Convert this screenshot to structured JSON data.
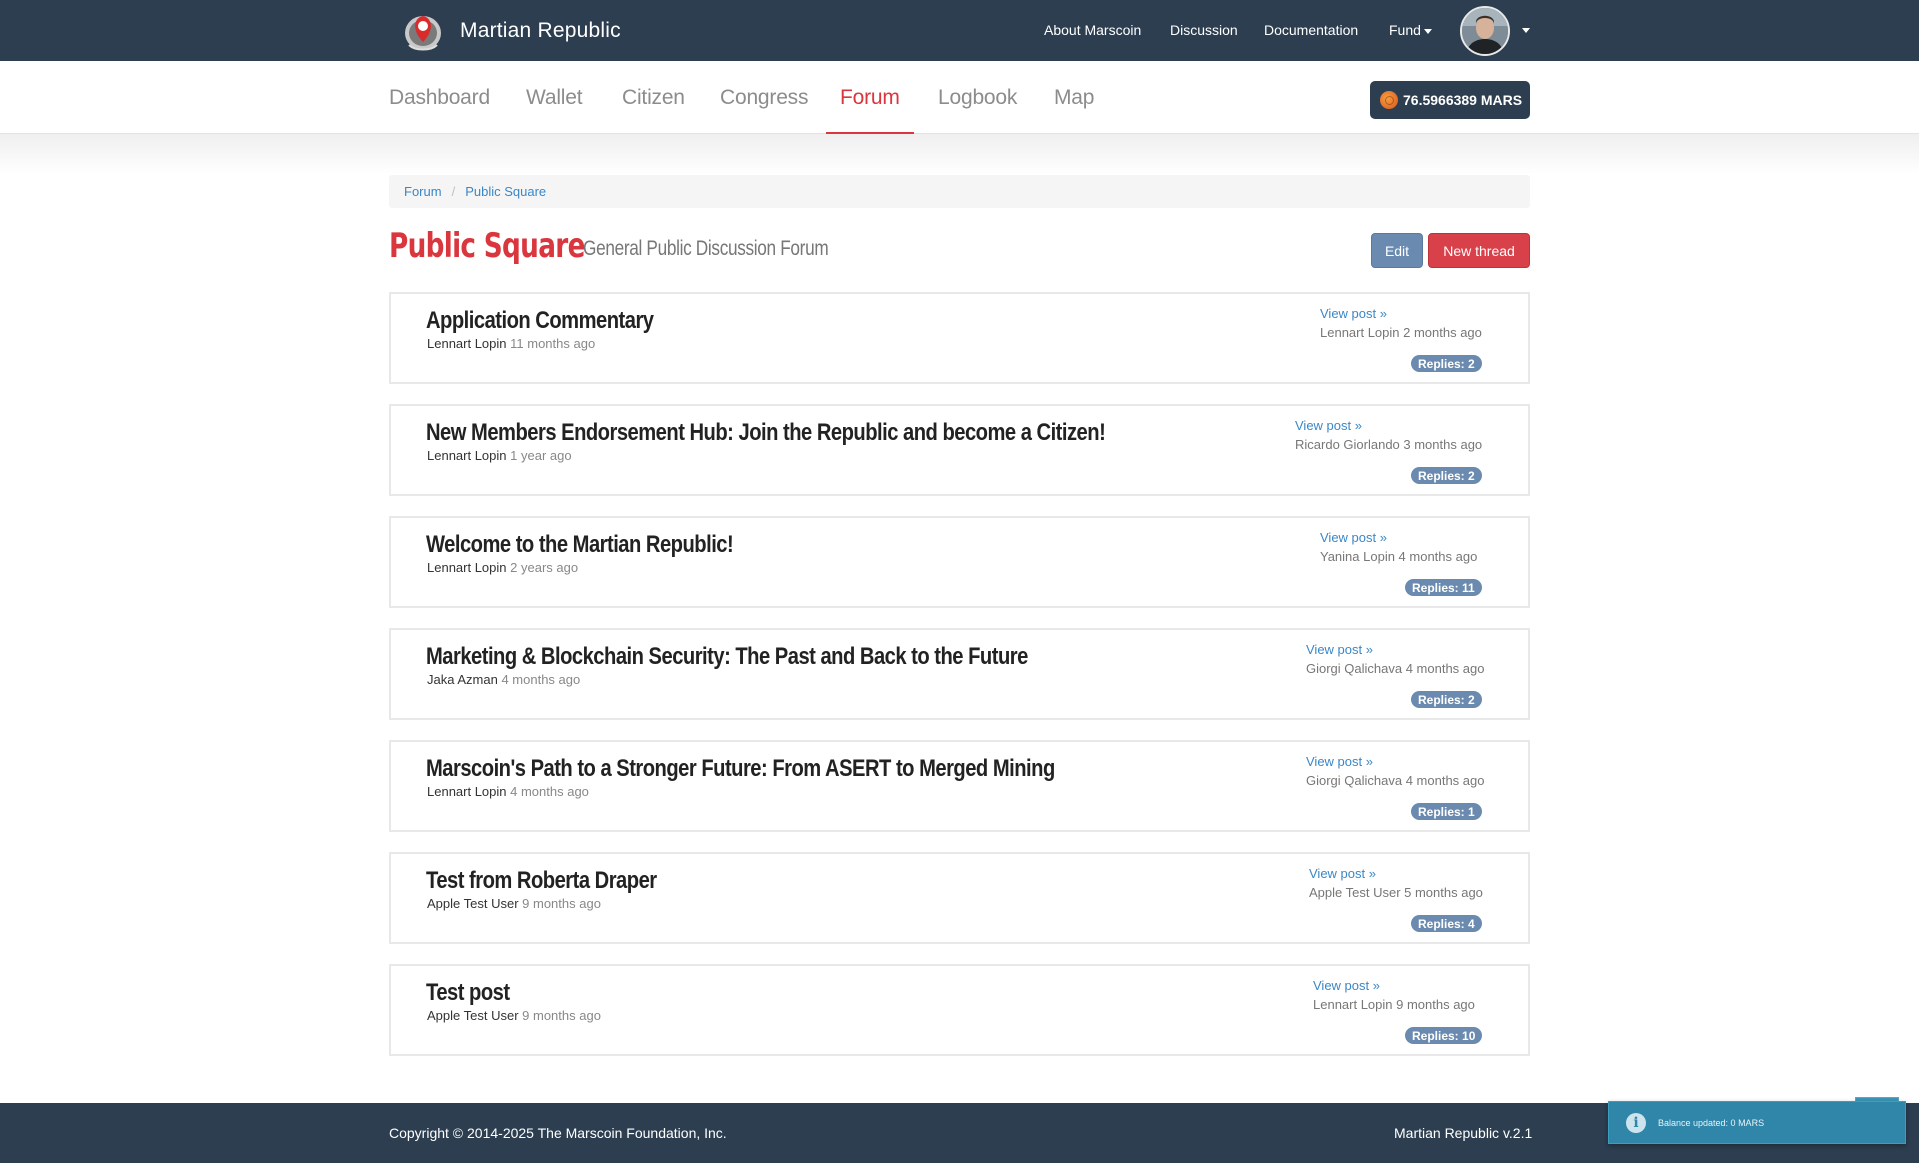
{
  "brand": {
    "name": "Martian Republic"
  },
  "top_nav": {
    "links": [
      "About Marscoin",
      "Discussion",
      "Documentation",
      "Fund"
    ]
  },
  "tabs": [
    "Dashboard",
    "Wallet",
    "Citizen",
    "Congress",
    "Forum",
    "Logbook",
    "Map"
  ],
  "active_tab": "Forum",
  "balance": {
    "label": "76.5966389 MARS"
  },
  "breadcrumb": [
    "Forum",
    "Public Square"
  ],
  "header": {
    "title": "Public Square",
    "subtitle": "General Public Discussion Forum",
    "edit_label": "Edit",
    "new_thread_label": "New thread"
  },
  "threads": [
    {
      "title": "Application Commentary",
      "author": "Lennart Lopin",
      "ago": "11 months ago",
      "view_label": "View post »",
      "last": "Lennart Lopin 2 months ago",
      "replies": "Replies: 2"
    },
    {
      "title": "New Members Endorsement Hub: Join the Republic and become a Citizen!",
      "author": "Lennart Lopin",
      "ago": "1 year ago",
      "view_label": "View post »",
      "last": "Ricardo Giorlando 3 months ago",
      "replies": "Replies: 2"
    },
    {
      "title": "Welcome to the Martian Republic!",
      "author": "Lennart Lopin",
      "ago": "2 years ago",
      "view_label": "View post »",
      "last": "Yanina Lopin 4 months ago",
      "replies": "Replies: 11"
    },
    {
      "title": "Marketing & Blockchain Security: The Past and Back to the Future",
      "author": "Jaka Azman",
      "ago": "4 months ago",
      "view_label": "View post »",
      "last": "Giorgi Qalichava 4 months ago",
      "replies": "Replies: 2"
    },
    {
      "title": "Marscoin's Path to a Stronger Future: From ASERT to Merged Mining",
      "author": "Lennart Lopin",
      "ago": "4 months ago",
      "view_label": "View post »",
      "last": "Giorgi Qalichava 4 months ago",
      "replies": "Replies: 1"
    },
    {
      "title": "Test from Roberta Draper",
      "author": "Apple Test User",
      "ago": "9 months ago",
      "view_label": "View post »",
      "last": "Apple Test User 5 months ago",
      "replies": "Replies: 4"
    },
    {
      "title": "Test post",
      "author": "Apple Test User",
      "ago": "9 months ago",
      "view_label": "View post »",
      "last": "Lennart Lopin 9 months ago",
      "replies": "Replies: 10"
    }
  ],
  "footer": {
    "copyright": "Copyright © 2014-2025 The Marscoin Foundation, Inc.",
    "version": "Martian Republic v.2.1"
  },
  "toast": {
    "message": "Balance updated: 0 MARS"
  },
  "colors": {
    "navbar": "#2c3e50",
    "accent": "#d9363e",
    "link": "#3a87c8",
    "badge": "#6a8ab0"
  }
}
